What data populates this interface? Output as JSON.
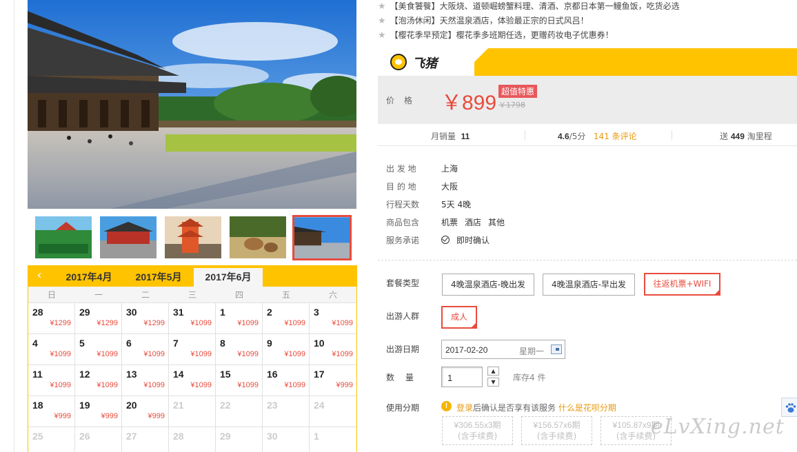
{
  "promotions": [
    "【美食饕餮】大阪烧、道顿崛螃蟹料理、清酒、京都日本第一鳗鱼饭，吃货必选",
    "【泡汤休闲】天然温泉酒店，体验最正宗的日式风吕！",
    "【樱花季早预定】樱花季多班期任选，更赠药妆电子优惠券！"
  ],
  "brand": {
    "name": "飞猪",
    "accent": "#ffc300"
  },
  "price": {
    "label": "价格",
    "current": "￥899",
    "badge": "超值特惠",
    "original": "￥1798"
  },
  "stats": {
    "monthly_sales_label": "月销量",
    "monthly_sales": "11",
    "rating": "4.6",
    "rating_suffix": "/5分",
    "reviews": "141 条评论",
    "mileage_prefix": "送",
    "mileage": "449",
    "mileage_suffix": "淘里程"
  },
  "details": [
    {
      "key": "出 发 地",
      "value": "上海"
    },
    {
      "key": "目 的 地",
      "value": "大阪"
    },
    {
      "key": "行程天数",
      "value": "5天 4晚"
    }
  ],
  "includes": {
    "key": "商品包含",
    "items": [
      "机票",
      "酒店",
      "其他"
    ]
  },
  "service": {
    "key": "服务承诺",
    "value": "即时确认"
  },
  "package": {
    "label": "套餐类型",
    "options": [
      "4晚温泉酒店-晚出发",
      "4晚温泉酒店-早出发",
      "往返机票+WIFI"
    ],
    "selected": 2
  },
  "travelers": {
    "label": "出游人群",
    "option": "成人"
  },
  "date": {
    "label": "出游日期",
    "value": "2017-02-20",
    "weekday": "星期一"
  },
  "quantity": {
    "label": "数　量",
    "value": "1",
    "stock": "库存4 件",
    "up": "▲",
    "down": "▼"
  },
  "installment": {
    "label": "使用分期",
    "login_link": "登录",
    "notice": "后确认是否享有该服务",
    "help_link": "什么是花呗分期",
    "plans": [
      {
        "amount": "¥306.55x3期",
        "fee": "(含手续费)"
      },
      {
        "amount": "¥156.57x6期",
        "fee": "(含手续费)"
      },
      {
        "amount": "¥105.87x9期",
        "fee": "(含手续费)"
      }
    ]
  },
  "calendar": {
    "prev": "‹",
    "tabs": [
      "2017年4月",
      "2017年5月",
      "2017年6月"
    ],
    "active_tab": 2,
    "weekdays": [
      "日",
      "一",
      "二",
      "三",
      "四",
      "五",
      "六"
    ],
    "cells": [
      {
        "d": "28",
        "p": "¥1299"
      },
      {
        "d": "29",
        "p": "¥1299"
      },
      {
        "d": "30",
        "p": "¥1299"
      },
      {
        "d": "31",
        "p": "¥1099"
      },
      {
        "d": "1",
        "p": "¥1099"
      },
      {
        "d": "2",
        "p": "¥1099"
      },
      {
        "d": "3",
        "p": "¥1099"
      },
      {
        "d": "4",
        "p": "¥1099"
      },
      {
        "d": "5",
        "p": "¥1099"
      },
      {
        "d": "6",
        "p": "¥1099"
      },
      {
        "d": "7",
        "p": "¥1099"
      },
      {
        "d": "8",
        "p": "¥1099"
      },
      {
        "d": "9",
        "p": "¥1099"
      },
      {
        "d": "10",
        "p": "¥1099"
      },
      {
        "d": "11",
        "p": "¥1099"
      },
      {
        "d": "12",
        "p": "¥1099"
      },
      {
        "d": "13",
        "p": "¥1099"
      },
      {
        "d": "14",
        "p": "¥1099"
      },
      {
        "d": "15",
        "p": "¥1099"
      },
      {
        "d": "16",
        "p": "¥1099"
      },
      {
        "d": "17",
        "p": "¥999"
      },
      {
        "d": "18",
        "p": "¥999"
      },
      {
        "d": "19",
        "p": "¥999"
      },
      {
        "d": "20",
        "p": "¥999"
      },
      {
        "d": "21",
        "p": "",
        "dis": true
      },
      {
        "d": "22",
        "p": "",
        "dis": true
      },
      {
        "d": "23",
        "p": "",
        "dis": true
      },
      {
        "d": "24",
        "p": "",
        "dis": true
      },
      {
        "d": "25",
        "p": "",
        "dis": true
      },
      {
        "d": "26",
        "p": "",
        "dis": true
      },
      {
        "d": "27",
        "p": "",
        "dis": true
      },
      {
        "d": "28",
        "p": "",
        "dis": true
      },
      {
        "d": "29",
        "p": "",
        "dis": true
      },
      {
        "d": "30",
        "p": "",
        "dis": true
      },
      {
        "d": "1",
        "p": "",
        "dis": true
      }
    ]
  },
  "thumbnails": [
    "thumb-1",
    "thumb-2",
    "thumb-3",
    "thumb-4",
    "thumb-5"
  ],
  "selected_thumbnail": 4,
  "watermark": "eLvXing.net",
  "colors": {
    "price_red": "#e84b3c",
    "orange_link": "#e89a0c",
    "brand_yellow": "#ffc300"
  }
}
